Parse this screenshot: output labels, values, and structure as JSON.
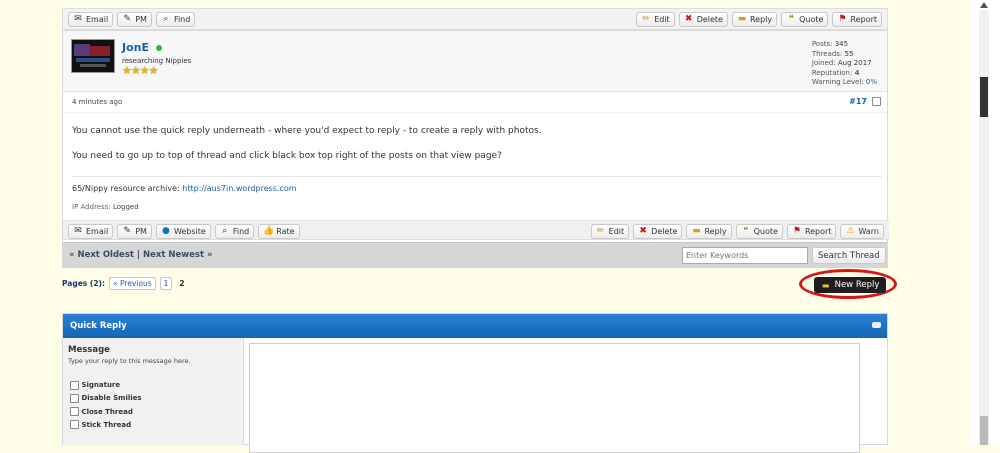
{
  "top_bar": {
    "left_buttons": [
      {
        "label": "Email",
        "icon": "envelope-icon"
      },
      {
        "label": "PM",
        "icon": "pm-icon"
      },
      {
        "label": "Find",
        "icon": "magnifier-icon"
      }
    ],
    "right_buttons": [
      {
        "label": "Edit",
        "icon": "pencil-icon"
      },
      {
        "label": "Delete",
        "icon": "x-icon"
      },
      {
        "label": "Reply",
        "icon": "speech-bubble-icon"
      },
      {
        "label": "Quote",
        "icon": "quote-icon"
      },
      {
        "label": "Report",
        "icon": "flag-icon"
      }
    ]
  },
  "post": {
    "author": {
      "name": "JonE",
      "online": true,
      "subtitle": "researching Nippies",
      "stars": 4
    },
    "stats": {
      "posts_label": "Posts:",
      "posts": "345",
      "threads_label": "Threads:",
      "threads": "55",
      "joined_label": "Joined:",
      "joined": "Aug 2017",
      "reputation_label": "Reputation:",
      "reputation": "4",
      "warning_label": "Warning Level:",
      "warning": "0%"
    },
    "time": "4 minutes ago",
    "number": "#17",
    "body": [
      "You cannot use the quick reply underneath - where you'd expect to reply - to create a reply with photos.",
      "You need to go up to top of thread and click black box top right of the posts on that view page?"
    ],
    "signature_prefix": "65/Nippy resource archive: ",
    "signature_link": "http://aus7in.wordpress.com",
    "ip_label": "IP Address:",
    "ip_value": "Logged",
    "left_buttons": [
      {
        "label": "Email",
        "icon": "envelope-icon"
      },
      {
        "label": "PM",
        "icon": "pm-icon"
      },
      {
        "label": "Website",
        "icon": "globe-icon"
      },
      {
        "label": "Find",
        "icon": "magnifier-icon"
      },
      {
        "label": "Rate",
        "icon": "thumbs-up-icon"
      }
    ],
    "right_buttons": [
      {
        "label": "Edit",
        "icon": "pencil-icon"
      },
      {
        "label": "Delete",
        "icon": "x-icon"
      },
      {
        "label": "Reply",
        "icon": "speech-bubble-icon"
      },
      {
        "label": "Quote",
        "icon": "quote-icon"
      },
      {
        "label": "Report",
        "icon": "flag-icon"
      },
      {
        "label": "Warn",
        "icon": "warning-icon"
      }
    ]
  },
  "thread_nav": {
    "oldest": "« Next Oldest",
    "separator": "|",
    "newest": "Next Newest »",
    "search_placeholder": "Enter Keywords",
    "search_button": "Search Thread"
  },
  "pagination": {
    "label": "Pages (2):",
    "previous": "« Previous",
    "page1": "1",
    "current": "2"
  },
  "new_reply": {
    "label": "New Reply",
    "highlight_color": "#d8141a"
  },
  "quick_reply": {
    "title": "Quick Reply",
    "header_color": "#1c6fc0",
    "message_label": "Message",
    "message_hint": "Type your reply to this message here.",
    "options": [
      "Signature",
      "Disable Smilies",
      "Close Thread",
      "Stick Thread"
    ]
  }
}
